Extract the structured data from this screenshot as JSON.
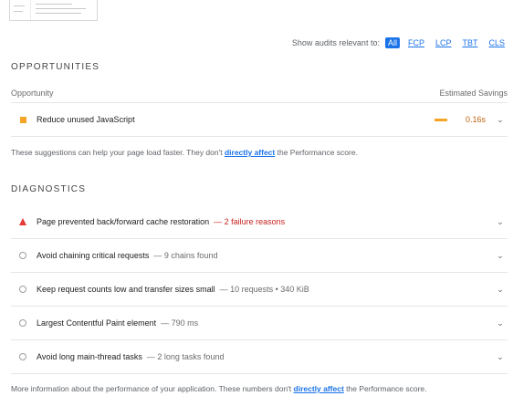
{
  "filters": {
    "label": "Show audits relevant to:",
    "chips": [
      "All",
      "FCP",
      "LCP",
      "TBT",
      "CLS"
    ]
  },
  "opportunities": {
    "title": "OPPORTUNITIES",
    "header_left": "Opportunity",
    "header_right": "Estimated Savings",
    "items": [
      {
        "title": "Reduce unused JavaScript",
        "savings": "0.16s"
      }
    ],
    "note_prefix": "These suggestions can help your page load faster. They don't ",
    "note_link": "directly affect",
    "note_suffix": " the Performance score."
  },
  "diagnostics": {
    "title": "DIAGNOSTICS",
    "items": [
      {
        "title": "Page prevented back/forward cache restoration",
        "meta": "— 2 failure reasons"
      },
      {
        "title": "Avoid chaining critical requests",
        "meta": "— 9 chains found"
      },
      {
        "title": "Keep request counts low and transfer sizes small",
        "meta": "— 10 requests • 340 KiB"
      },
      {
        "title": "Largest Contentful Paint element",
        "meta": "— 790 ms"
      },
      {
        "title": "Avoid long main-thread tasks",
        "meta": "— 2 long tasks found"
      }
    ],
    "note_prefix": "More information about the performance of your application. These numbers don't ",
    "note_link": "directly affect",
    "note_suffix": " the Performance score."
  },
  "colors": {
    "accent": "#1a73e8",
    "average": "#f4a427",
    "fail": "#e53935"
  }
}
